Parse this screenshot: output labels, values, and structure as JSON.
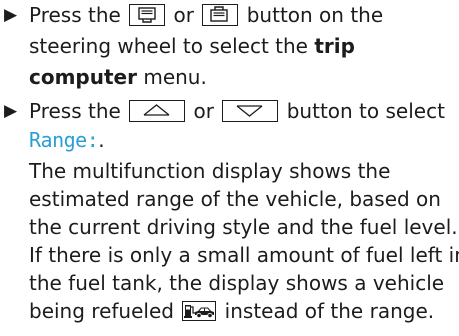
{
  "step1": {
    "bullet": "▶",
    "line1_prefix": "Press the",
    "line1_or": "or",
    "line1_suffix": "button on the",
    "line2_prefix": "steering wheel to select the",
    "line2_bold": "trip",
    "line3_bold": "computer",
    "line3_suffix": "menu.",
    "icons": [
      "display-page-left-icon",
      "display-page-right-icon"
    ]
  },
  "step2": {
    "bullet": "▶",
    "line1_prefix": "Press the",
    "line1_or": "or",
    "line1_suffix": "button to select",
    "display_text": "Range:",
    "display_suffix": ".",
    "icons": [
      "arrow-up-icon",
      "arrow-down-icon"
    ],
    "description": [
      "The multifunction display shows the",
      "estimated range of the vehicle, based on",
      "the current driving style and the fuel level.",
      "If there is only a small amount of fuel left in",
      "the fuel tank, the display shows a vehicle"
    ],
    "last_line_prefix": "being refueled",
    "last_line_suffix": "instead of the range.",
    "refuel_icon": "vehicle-refuel-icon"
  },
  "colors": {
    "text": "#1c1c1c",
    "display_text": "#2a9fd6"
  }
}
